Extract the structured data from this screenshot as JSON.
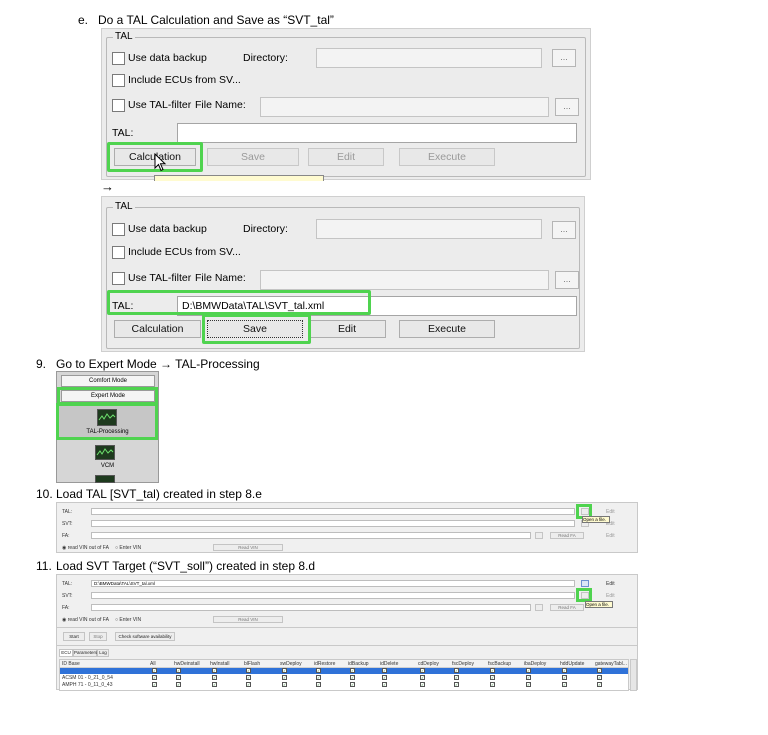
{
  "steps": {
    "e": {
      "num": "e.",
      "text": "Do a TAL Calculation and Save as “SVT_tal”"
    },
    "s9": {
      "num": "9.",
      "text": "Go to Expert Mode → TAL-Processing"
    },
    "s10": {
      "num": "10.",
      "text": "Load TAL [SVT_tal) created in step 8.e"
    },
    "s11": {
      "num": "11.",
      "text": "Load SVT Target (“SVT_soll”) created in step 8.d"
    }
  },
  "arrow": "→",
  "tal_panel": {
    "group": "TAL",
    "use_backup": "Use data backup",
    "directory": "Directory:",
    "include_ecus": "Include ECUs from SV...",
    "use_filter": "Use TAL-filter",
    "file_name": "File Name:",
    "tal": "TAL:",
    "tal_value": "D:\\BMWData\\TAL\\SVT_tal.xml",
    "dots": "...",
    "buttons": {
      "calc": "Calculation",
      "save": "Save",
      "edit": "Edit",
      "execute": "Execute"
    }
  },
  "mode_panel": {
    "comfort": "Comfort Mode",
    "expert": "Expert Mode",
    "tal_processing": "TAL-Processing",
    "vcm": "VCM"
  },
  "load_panel": {
    "tal": "TAL:",
    "svt": "SVT:",
    "fa": "FA:",
    "edit": "Edit",
    "read_fa": "Read FA",
    "open_file": "Open a file.",
    "read_vin_fa": "read VIN out of FA",
    "enter_vin": "Enter VIN",
    "read_vin": "Read VIN",
    "tal_path": "D:\\BMWData\\TAL\\SVT_tal.xml"
  },
  "bottom_panel": {
    "start": "Start",
    "stop": "Stop",
    "check": "Check software availability",
    "tabs": [
      "ECU",
      "Parameters",
      "Log"
    ],
    "columns": [
      "ID Base",
      "All",
      "hwDeinstall",
      "hwInstall",
      "blFlash",
      "swDeploy",
      "idRestore",
      "idBackup",
      "idDelete",
      "cdDeploy",
      "fscDeploy",
      "fscBackup",
      "ibaDeploy",
      "hddUpdate",
      "gatewayTabl..."
    ],
    "rows": [
      "",
      "ACSM 01 - 0_21_0_54",
      "AMPH 71 - 0_11_0_43"
    ]
  }
}
